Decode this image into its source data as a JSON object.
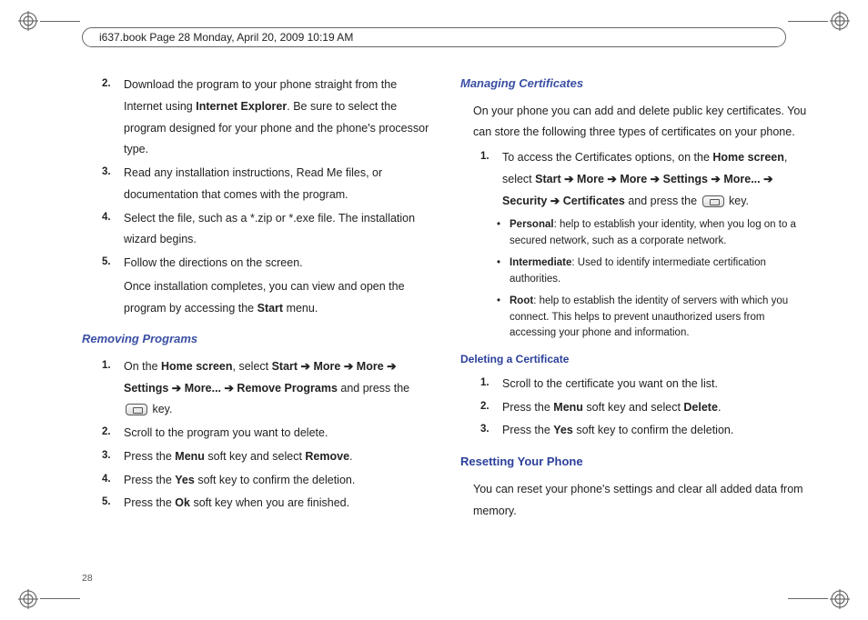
{
  "header_caption": "i637.book  Page 28  Monday, April 20, 2009  10:19 AM",
  "page_number": "28",
  "left": {
    "step2_a": "Download the program to your phone straight from the Internet using ",
    "step2_b": "Internet Explorer",
    "step2_c": ". Be sure to select the program designed for your phone and the phone's processor type.",
    "step3": "Read any installation instructions, Read Me files, or documentation that comes with the program.",
    "step4": "Select the file, such as a *.zip or *.exe file. The installation wizard begins.",
    "step5": "Follow the directions on the screen.",
    "step5_cont_a": "Once installation completes, you can view and open the program by accessing the ",
    "step5_cont_b": "Start",
    "step5_cont_c": " menu.",
    "removing_h": "Removing Programs",
    "r1_a": "On the ",
    "r1_b": "Home screen",
    "r1_c": ", select ",
    "r1_d": "Start ➔ More ➔ More ➔ Settings ➔ More... ➔ Remove Programs",
    "r1_e": " and press the ",
    "r1_f": " key.",
    "r2": "Scroll to the program you want to delete.",
    "r3_a": "Press the ",
    "r3_b": "Menu",
    "r3_c": " soft key and select ",
    "r3_d": "Remove",
    "r3_e": ".",
    "r4_a": "Press the ",
    "r4_b": "Yes",
    "r4_c": " soft key to confirm the deletion.",
    "r5_a": "Press the ",
    "r5_b": "Ok",
    "r5_c": " soft key when you are finished."
  },
  "right": {
    "managing_h": "Managing Certificates",
    "intro": "On your phone you can add and delete public key certificates. You can store the following three types of certificates on your phone.",
    "c1_a": "To access the Certificates options, on the ",
    "c1_b": "Home screen",
    "c1_c": ", select ",
    "c1_d": "Start ➔ More ➔ More ➔ Settings ➔ More... ➔ Security ➔ Certificates",
    "c1_e": " and press the ",
    "c1_f": " key.",
    "b1_a": "Personal",
    "b1_b": ": help to establish your identity, when you log on to a secured network, such as a corporate network.",
    "b2_a": "Intermediate",
    "b2_b": ": Used to identify intermediate certification authorities.",
    "b3_a": "Root",
    "b3_b": ": help to establish the identity of servers with which you connect. This helps to prevent unauthorized users from accessing your phone and information.",
    "deleting_h": "Deleting a Certificate",
    "d1": "Scroll to the certificate you want on the list.",
    "d2_a": "Press the ",
    "d2_b": "Menu",
    "d2_c": " soft key and select ",
    "d2_d": "Delete",
    "d2_e": ".",
    "d3_a": "Press the ",
    "d3_b": "Yes",
    "d3_c": " soft key to confirm the deletion.",
    "resetting_h": "Resetting Your Phone",
    "resetting_p": "You can reset your phone's settings and clear all added data from memory."
  },
  "nums": {
    "n1": "1.",
    "n2": "2.",
    "n3": "3.",
    "n4": "4.",
    "n5": "5."
  },
  "bullet": "•"
}
